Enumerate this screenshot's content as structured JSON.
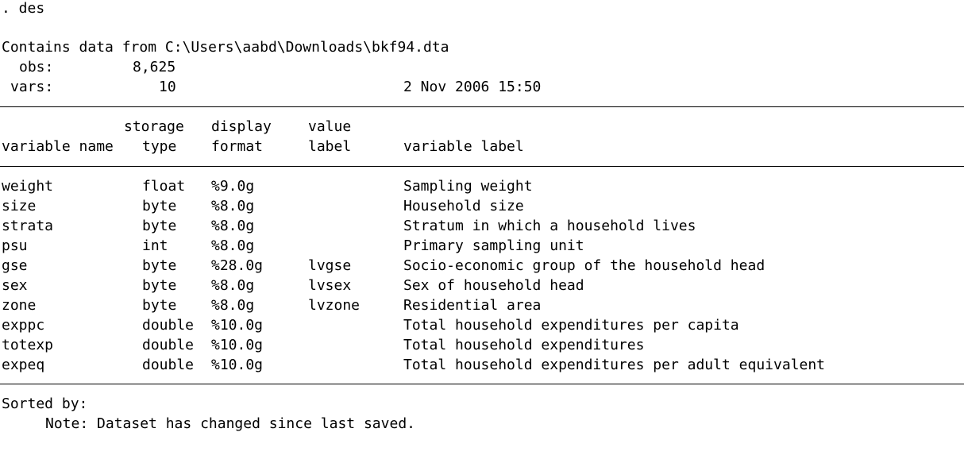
{
  "command": ". des",
  "header": {
    "contains": "Contains data from C:\\Users\\aabd\\Downloads\\bkf94.dta",
    "obs_label": "obs:",
    "obs_value": "8,625",
    "vars_label": "vars:",
    "vars_value": "10",
    "timestamp": "2 Nov 2006 15:50"
  },
  "columns": {
    "var_name": "variable name",
    "storage_top": "storage",
    "storage_bottom": "type",
    "display_top": "display",
    "display_bottom": "format",
    "value_top": "value",
    "value_bottom": "label",
    "var_label": "variable label"
  },
  "variables": [
    {
      "name": "weight",
      "type": "float",
      "format": "%9.0g",
      "value_label": "",
      "label": "Sampling weight"
    },
    {
      "name": "size",
      "type": "byte",
      "format": "%8.0g",
      "value_label": "",
      "label": "Household size"
    },
    {
      "name": "strata",
      "type": "byte",
      "format": "%8.0g",
      "value_label": "",
      "label": "Stratum in which a household lives"
    },
    {
      "name": "psu",
      "type": "int",
      "format": "%8.0g",
      "value_label": "",
      "label": "Primary sampling unit"
    },
    {
      "name": "gse",
      "type": "byte",
      "format": "%28.0g",
      "value_label": "lvgse",
      "label": "Socio-economic group of the household head"
    },
    {
      "name": "sex",
      "type": "byte",
      "format": "%8.0g",
      "value_label": "lvsex",
      "label": "Sex of household head"
    },
    {
      "name": "zone",
      "type": "byte",
      "format": "%8.0g",
      "value_label": "lvzone",
      "label": "Residential area"
    },
    {
      "name": "exppc",
      "type": "double",
      "format": "%10.0g",
      "value_label": "",
      "label": "Total household expenditures per capita"
    },
    {
      "name": "totexp",
      "type": "double",
      "format": "%10.0g",
      "value_label": "",
      "label": "Total household expenditures"
    },
    {
      "name": "expeq",
      "type": "double",
      "format": "%10.0g",
      "value_label": "",
      "label": "Total household expenditures per adult equivalent"
    }
  ],
  "footer": {
    "sorted_by": "Sorted by:",
    "note": "Note: Dataset has changed since last saved."
  }
}
